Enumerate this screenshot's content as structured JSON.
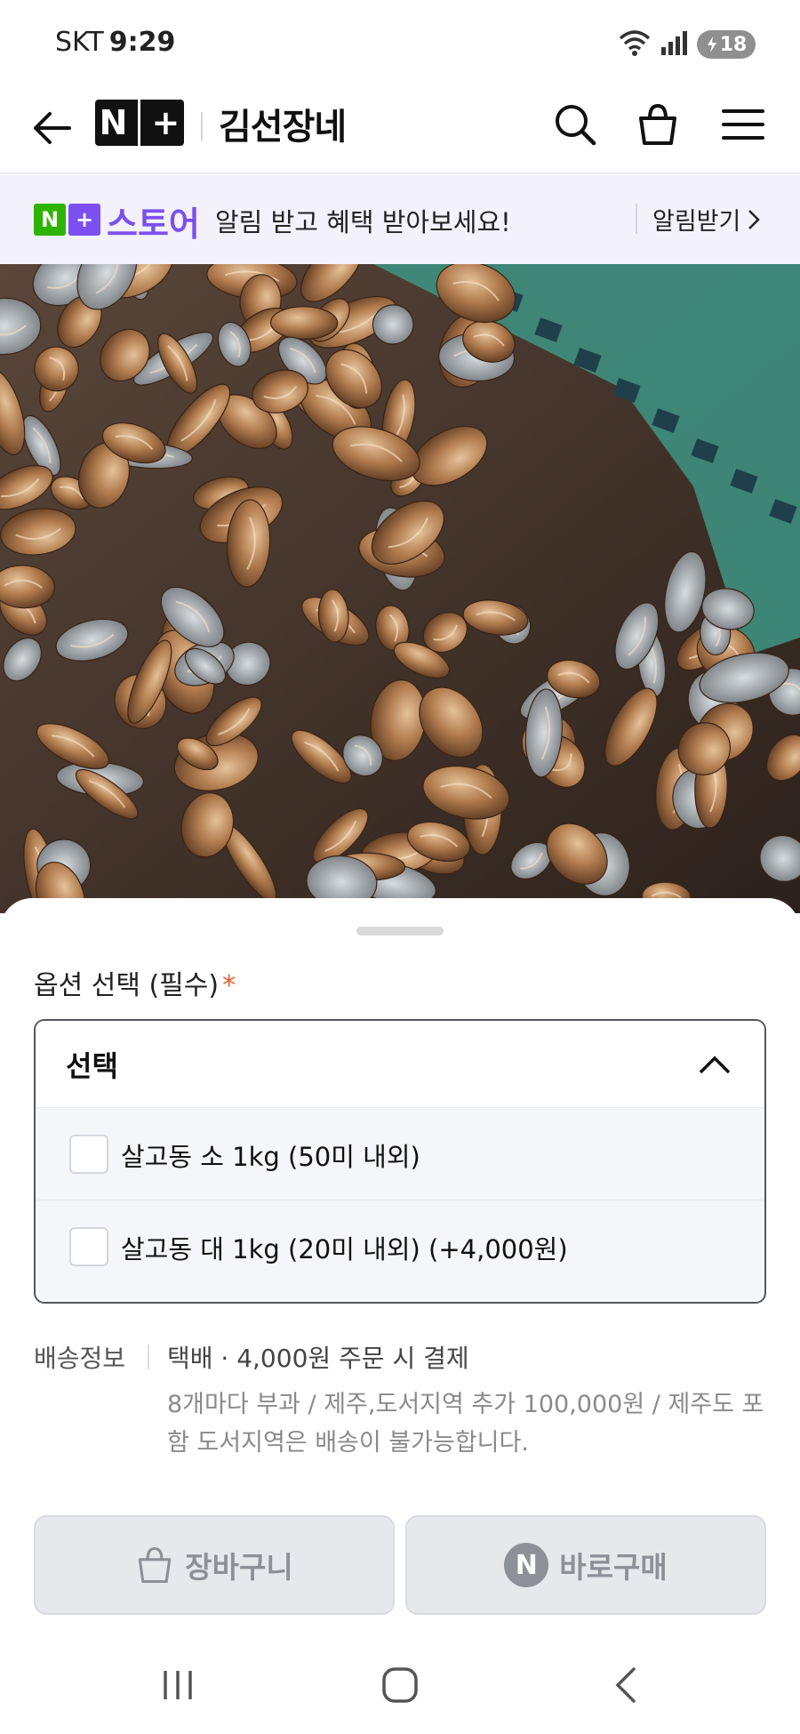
{
  "status_bar": {
    "carrier": "SKT",
    "time": "9:29",
    "battery": "18",
    "icons": [
      "wifi-icon",
      "signal-icon",
      "battery-charging-icon"
    ]
  },
  "header": {
    "logo": "N+",
    "store_name": "김선장네",
    "icons": [
      "back-arrow-icon",
      "search-icon",
      "shopping-bag-icon",
      "menu-icon"
    ]
  },
  "promo": {
    "brand_logo": "N+",
    "brand_text": "스토어",
    "message": "알림 받고 혜택 받아보세요!",
    "cta": "알림받기"
  },
  "product_image": {
    "alt": "살고동"
  },
  "option_sheet": {
    "title": "옵션 선택 (필수)",
    "required_mark": "*",
    "dropdown_label": "선택",
    "options": [
      {
        "label": "살고동 소 1kg (50미 내외)",
        "checked": false
      },
      {
        "label": "살고동 대 1kg (20미 내외) (+4,000원)",
        "checked": false
      }
    ]
  },
  "shipping": {
    "label": "배송정보",
    "main": "택배 · 4,000원 주문 시 결제",
    "detail": "8개마다 부과 / 제주,도서지역 추가 100,000원 / 제주도 포함 도서지역은 배송이 불가능합니다."
  },
  "actions": {
    "cart_label": "장바구니",
    "buy_label": "바로구매",
    "buy_badge": "N"
  },
  "colors": {
    "accent_purple": "#7b4ff0",
    "naver_green": "#2db400",
    "required_red": "#ef5a2f",
    "disabled_button": "#e6e8ec"
  }
}
